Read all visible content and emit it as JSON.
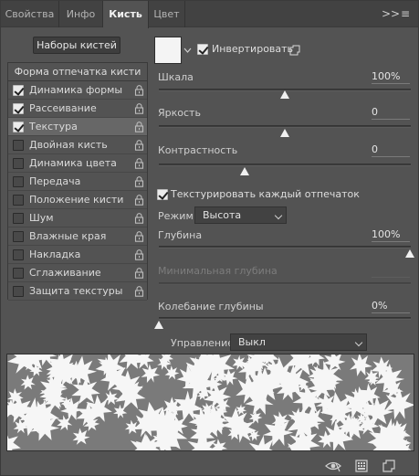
{
  "tabs": [
    {
      "label": "Свойства",
      "active": false
    },
    {
      "label": "Инфо",
      "active": false
    },
    {
      "label": "Кисть",
      "active": true
    },
    {
      "label": "Цвет",
      "active": false
    }
  ],
  "tab_menu": {
    "expand_glyph": ">>",
    "menu_glyph": "≡"
  },
  "left": {
    "presets_button": "Наборы кистей",
    "tip_shape_header": "Форма отпечатка кисти",
    "options": [
      {
        "label": "Динамика формы",
        "checked": true,
        "selected": false
      },
      {
        "label": "Рассеивание",
        "checked": true,
        "selected": false
      },
      {
        "label": "Текстура",
        "checked": true,
        "selected": true
      },
      {
        "label": "Двойная кисть",
        "checked": false,
        "selected": false
      },
      {
        "label": "Динамика цвета",
        "checked": false,
        "selected": false
      },
      {
        "label": "Передача",
        "checked": false,
        "selected": false
      },
      {
        "label": "Положение кисти",
        "checked": false,
        "selected": false
      },
      {
        "label": "Шум",
        "checked": false,
        "selected": false
      },
      {
        "label": "Влажные края",
        "checked": false,
        "selected": false
      },
      {
        "label": "Накладка",
        "checked": false,
        "selected": false
      },
      {
        "label": "Сглаживание",
        "checked": false,
        "selected": false
      },
      {
        "label": "Защита текстуры",
        "checked": false,
        "selected": false
      }
    ]
  },
  "texture": {
    "invert_label": "Инвертировать",
    "invert_checked": true,
    "scale": {
      "label": "Шкала",
      "value": "100%",
      "level": 0.5
    },
    "brightness": {
      "label": "Яркость",
      "value": "0",
      "level": 0.5
    },
    "contrast": {
      "label": "Контрастность",
      "value": "0",
      "level": 0.34
    },
    "texture_each_tip_label": "Текстурировать каждый отпечаток",
    "texture_each_tip_checked": true,
    "mode_label": "Режим:",
    "mode_value": "Высота",
    "depth": {
      "label": "Глубина",
      "value": "100%",
      "level": 1.0
    },
    "min_depth": {
      "label": "Минимальная глубина",
      "value": "",
      "enabled": false
    },
    "depth_jitter": {
      "label": "Колебание глубины",
      "value": "0%",
      "level": 0.0
    },
    "control_label": "Управление:",
    "control_value": "Выкл"
  },
  "colors": {
    "panel_bg": "#535353",
    "tab_bg": "#424242",
    "selected_row": "#676767",
    "preview_bg": "#f6f6f6",
    "preview_texture": "#7a7a7a"
  }
}
